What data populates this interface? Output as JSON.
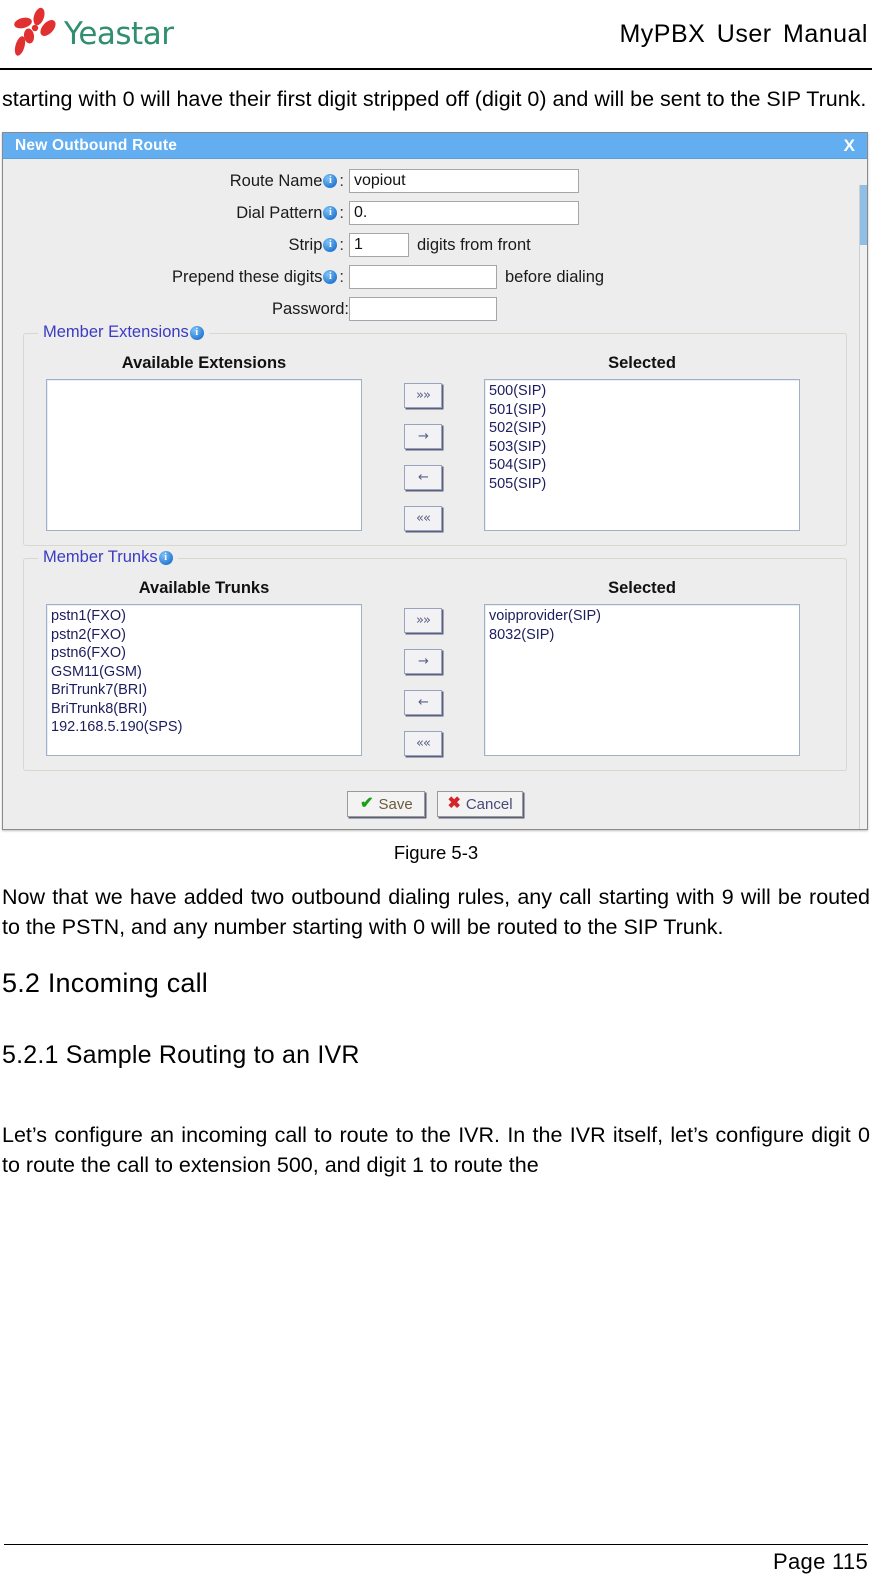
{
  "header": {
    "logo_text": "Yeastar",
    "logo_icon": "yeastar-flower-logo",
    "manual_title": "MyPBX User Manual"
  },
  "body": {
    "intro_paragraph": "starting with 0 will have their first digit stripped off (digit 0) and will be sent to the SIP Trunk.",
    "figure_caption": "Figure 5-3",
    "after_figure_paragraph": "Now that we have added two outbound dialing rules, any call starting with 9 will be routed to the PSTN, and any number starting with 0 will be routed to the SIP Trunk.",
    "heading_52": "5.2 Incoming call",
    "heading_521": "5.2.1 Sample Routing to an IVR",
    "closing_paragraph": "Let’s configure an incoming call to route to the IVR. In the IVR itself, let’s configure digit 0 to route the call to extension 500, and digit 1 to route the"
  },
  "dialog": {
    "title": "New Outbound Route",
    "close_label": "X",
    "titlebar_color": "#62aef0",
    "body_color": "#ededed",
    "fields": {
      "route_name": {
        "label": "Route Name",
        "colon": ":",
        "value": "vopiout",
        "placeholder": ""
      },
      "dial_pattern": {
        "label": "Dial Pattern",
        "colon": ":",
        "value": "0.",
        "placeholder": ""
      },
      "strip": {
        "label": "Strip",
        "colon": ":",
        "value": "1",
        "suffix": "digits from front",
        "placeholder": ""
      },
      "prepend": {
        "label": "Prepend these digits",
        "colon": ":",
        "value": "",
        "suffix": "before dialing",
        "placeholder": ""
      },
      "password": {
        "label": "Password:",
        "value": "",
        "placeholder": ""
      }
    },
    "member_extensions": {
      "legend": "Member Extensions",
      "available_title": "Available Extensions",
      "selected_title": "Selected",
      "available": [],
      "selected": [
        "500(SIP)",
        "501(SIP)",
        "502(SIP)",
        "503(SIP)",
        "504(SIP)",
        "505(SIP)"
      ]
    },
    "member_trunks": {
      "legend": "Member Trunks",
      "available_title": "Available Trunks",
      "selected_title": "Selected",
      "available": [
        "pstn1(FXO)",
        "pstn2(FXO)",
        "pstn6(FXO)",
        "GSM11(GSM)",
        "BriTrunk7(BRI)",
        "BriTrunk8(BRI)",
        "192.168.5.190(SPS)"
      ],
      "selected": [
        "voipprovider(SIP)",
        "8032(SIP)"
      ]
    },
    "transfer_buttons": {
      "add_all": "»»",
      "add_one": "→",
      "remove_one": "←",
      "remove_all": "««"
    },
    "actions": {
      "save": "Save",
      "cancel": "Cancel",
      "save_icon": "green-check-icon",
      "cancel_icon": "red-x-icon"
    },
    "info_icon_char": "i"
  },
  "footer": {
    "page_label": "Page 115"
  }
}
